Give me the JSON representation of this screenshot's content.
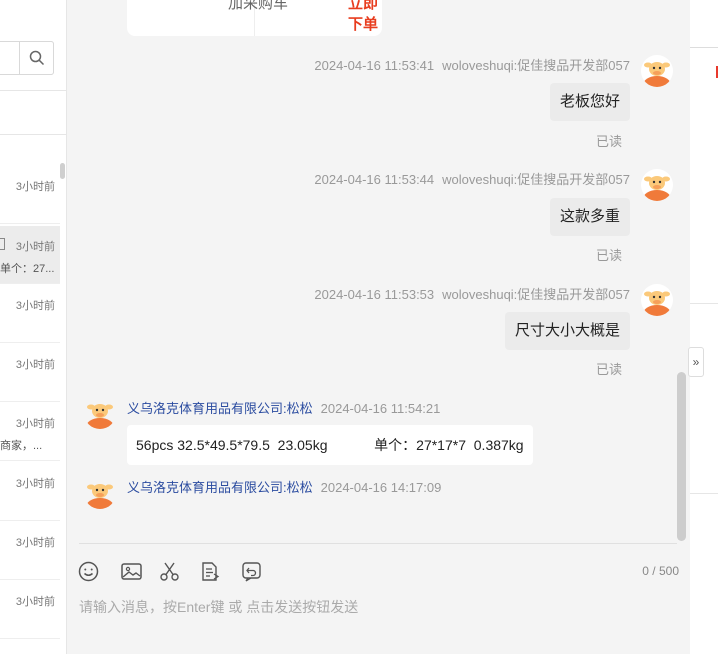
{
  "sidebar": {
    "conversations": [
      {
        "time": "3小时前",
        "preview": ""
      },
      {
        "time": "3小时前",
        "preview": "单个：27..."
      },
      {
        "time": "3小时前",
        "preview": ""
      },
      {
        "time": "3小时前",
        "preview": ""
      },
      {
        "time": "3小时前",
        "preview": "商家，..."
      },
      {
        "time": "3小时前",
        "preview": ""
      },
      {
        "time": "3小时前",
        "preview": ""
      },
      {
        "time": "3小时前",
        "preview": ""
      }
    ]
  },
  "product_card": {
    "add_cart": "加采购车",
    "buy_now": "立即下单"
  },
  "messages": [
    {
      "timestamp": "2024-04-16 11:53:41",
      "sender": "woloveshuqi:促佳搜品开发部057",
      "text": "老板您好",
      "status": "已读"
    },
    {
      "timestamp": "2024-04-16 11:53:44",
      "sender": "woloveshuqi:促佳搜品开发部057",
      "text": "这款多重",
      "status": "已读"
    },
    {
      "timestamp": "2024-04-16 11:53:53",
      "sender": "woloveshuqi:促佳搜品开发部057",
      "text": "尺寸大小大概是",
      "status": "已读"
    },
    {
      "timestamp": "2024-04-16 11:54:21",
      "sender": "义乌洛克体育用品有限公司:松松",
      "text": "56pcs 32.5*49.5*79.5  23.05kg            单个：27*17*7  0.387kg"
    },
    {
      "timestamp": "2024-04-16 14:17:09",
      "sender": "义乌洛克体育用品有限公司:松松",
      "text": ""
    }
  ],
  "composer": {
    "placeholder": "请输入消息，按Enter键 或 点击发送按钮发送",
    "counter": "0 / 500"
  },
  "icons": {
    "emoji": "emoji-icon",
    "image": "image-icon",
    "scissors": "scissors-icon",
    "document": "document-icon",
    "recall": "recall-icon",
    "collapse": "chevron-double-right-icon"
  },
  "colors": {
    "accent_red": "#e83d1f",
    "sender_blue": "#2b4ca0",
    "avatar_orange": "#f07a3a"
  }
}
